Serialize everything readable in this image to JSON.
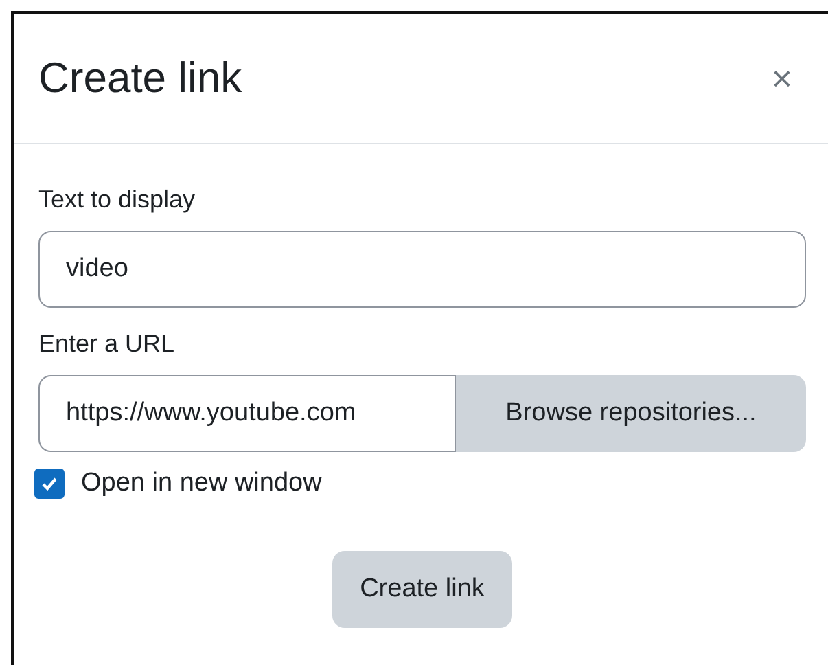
{
  "dialog": {
    "title": "Create link",
    "close": "×"
  },
  "fields": [
    {
      "label": "Text to display",
      "value": "video"
    }
  ],
  "url": {
    "label": "Enter a URL",
    "value": "https://www.youtube.com",
    "button": "Browse repositories..."
  },
  "open_in_new_window": {
    "label": "Open in new window",
    "checked": true
  },
  "submit": "Create link"
}
